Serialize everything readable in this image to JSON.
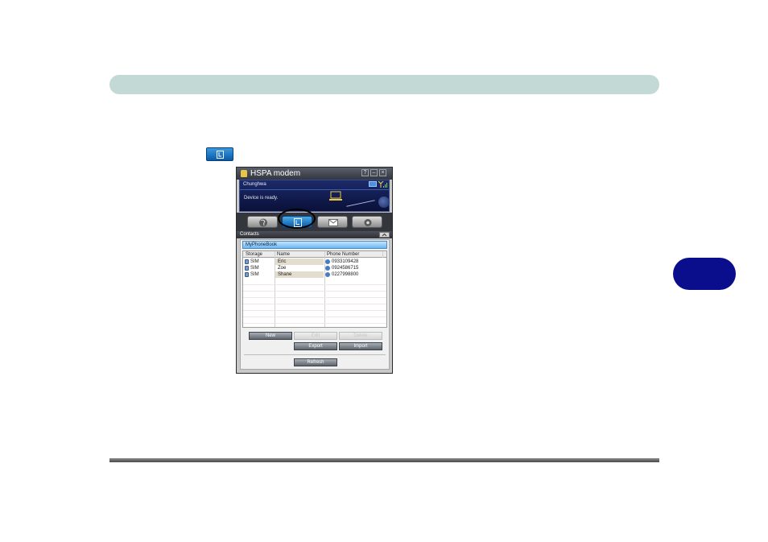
{
  "window": {
    "title": "HSPA modem",
    "controls": {
      "help": "?",
      "minimize": "–",
      "close": "×"
    }
  },
  "status": {
    "carrier": "Chunghwa",
    "message": "Device is ready."
  },
  "nav": {
    "tabs": [
      {
        "name": "internet",
        "icon": "globe-icon"
      },
      {
        "name": "phonebook",
        "icon": "phone-icon",
        "active": true
      },
      {
        "name": "sms",
        "icon": "envelope-icon"
      },
      {
        "name": "settings",
        "icon": "gear-icon"
      }
    ]
  },
  "contacts": {
    "section_label": "Contacts",
    "phonebook_name": "MyPhoneBook",
    "columns": [
      "Storage",
      "Name",
      "Phone Number"
    ],
    "rows": [
      {
        "storage": "SIM",
        "name": "Eric",
        "phone": "0933109428"
      },
      {
        "storage": "SIM",
        "name": "Zoe",
        "phone": "0924586715"
      },
      {
        "storage": "SIM",
        "name": "Shane",
        "phone": "0227998800"
      }
    ],
    "buttons": {
      "new": "New",
      "edit": "Edit",
      "delete": "Delete",
      "export": "Export",
      "import": "Import",
      "refresh": "Refresh"
    }
  },
  "colors": {
    "header_bar": "#c3d9d5",
    "chapter_tab": "#0b0e8c",
    "active_tab": "#1a7ad0"
  }
}
